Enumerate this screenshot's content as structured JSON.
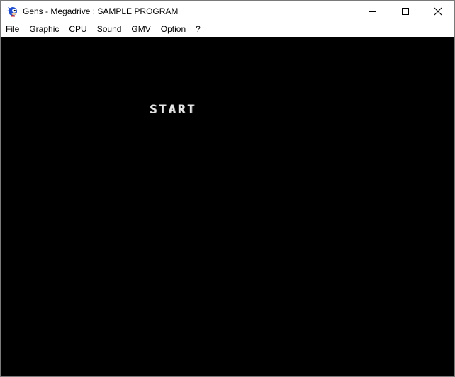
{
  "window": {
    "title": "Gens - Megadrive : SAMPLE PROGRAM",
    "icon": "sonic-app-icon"
  },
  "caption_buttons": {
    "minimize": "minimize-icon",
    "maximize": "maximize-icon",
    "close": "close-icon"
  },
  "menu": {
    "items": [
      {
        "label": "File"
      },
      {
        "label": "Graphic"
      },
      {
        "label": "CPU"
      },
      {
        "label": "Sound"
      },
      {
        "label": "GMV"
      },
      {
        "label": "Option"
      },
      {
        "label": "?"
      }
    ]
  },
  "game_screen": {
    "text": "START",
    "background": "#000000",
    "text_color": "#e8e8e8"
  }
}
